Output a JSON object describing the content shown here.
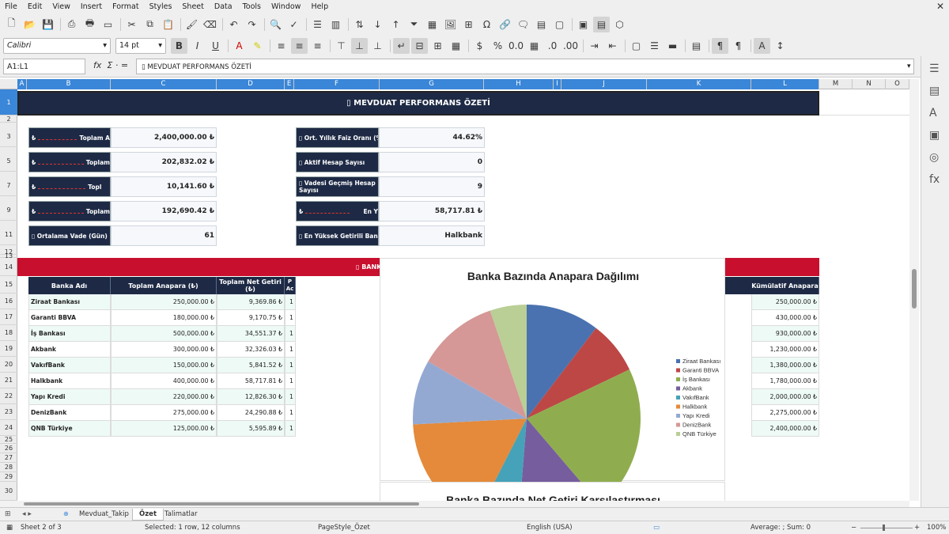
{
  "menu": [
    "File",
    "Edit",
    "View",
    "Insert",
    "Format",
    "Styles",
    "Sheet",
    "Data",
    "Tools",
    "Window",
    "Help"
  ],
  "font": {
    "name": "Calibri",
    "size": "14 pt"
  },
  "namebox": "A1:L1",
  "formula": "▯ MEVDUAT PERFORMANS ÖZETİ",
  "columns": [
    "A",
    "B",
    "C",
    "D",
    "E",
    "F",
    "G",
    "H",
    "I",
    "J",
    "K",
    "L",
    "M",
    "N",
    "O"
  ],
  "rows": [
    "1",
    "2",
    "3",
    "5",
    "7",
    "9",
    "11",
    "12",
    "13",
    "14",
    "15",
    "16",
    "17",
    "18",
    "19",
    "20",
    "21",
    "22",
    "23",
    "24",
    "25",
    "26",
    "27",
    "28",
    "29",
    "30"
  ],
  "title": "▯ MEVDUAT PERFORMANS ÖZETİ",
  "left_cards": [
    {
      "label": "Toplam A",
      "value": "2,400,000.00 ₺"
    },
    {
      "label": "Toplam ",
      "value": "202,832.02 ₺"
    },
    {
      "label": "Topl",
      "value": "10,141.60 ₺"
    },
    {
      "label": "Toplam",
      "value": "192,690.42 ₺"
    },
    {
      "label": "▯ Ortalama Vade (Gün)",
      "value": "61"
    }
  ],
  "right_cards": [
    {
      "label": "▯ Ort. Yıllık Faiz Oranı (%)",
      "value": "44.62%"
    },
    {
      "label": "▯ Aktif Hesap Sayısı",
      "value": "0"
    },
    {
      "label": "▯ Vadesi Geçmiş Hesap Sayısı",
      "value": "9"
    },
    {
      "label": "En Y",
      "value": "58,717.81 ₺"
    },
    {
      "label": "▯ En Yüksek Getirili Banka",
      "value": "Halkbank"
    }
  ],
  "section_banner": "▯ BANK",
  "table": {
    "headers": [
      "Banka Adı",
      "Toplam Anapara (₺)",
      "Toplam Net Getiri (₺)",
      "P Ac",
      "Kümülatif Anapara"
    ],
    "rows": [
      {
        "bank": "Ziraat Bankası",
        "principal": "250,000.00 ₺",
        "net": "9,369.86 ₺",
        "p": "1",
        "cum": "250,000.00 ₺"
      },
      {
        "bank": "Garanti BBVA",
        "principal": "180,000.00 ₺",
        "net": "9,170.75 ₺",
        "p": "1",
        "cum": "430,000.00 ₺"
      },
      {
        "bank": "İş Bankası",
        "principal": "500,000.00 ₺",
        "net": "34,551.37 ₺",
        "p": "1",
        "cum": "930,000.00 ₺"
      },
      {
        "bank": "Akbank",
        "principal": "300,000.00 ₺",
        "net": "32,326.03 ₺",
        "p": "1",
        "cum": "1,230,000.00 ₺"
      },
      {
        "bank": "VakıfBank",
        "principal": "150,000.00 ₺",
        "net": "5,841.52 ₺",
        "p": "1",
        "cum": "1,380,000.00 ₺"
      },
      {
        "bank": "Halkbank",
        "principal": "400,000.00 ₺",
        "net": "58,717.81 ₺",
        "p": "1",
        "cum": "1,780,000.00 ₺"
      },
      {
        "bank": "Yapı Kredi",
        "principal": "220,000.00 ₺",
        "net": "12,826.30 ₺",
        "p": "1",
        "cum": "2,000,000.00 ₺"
      },
      {
        "bank": "DenizBank",
        "principal": "275,000.00 ₺",
        "net": "24,290.88 ₺",
        "p": "1",
        "cum": "2,275,000.00 ₺"
      },
      {
        "bank": "QNB Türkiye",
        "principal": "125,000.00 ₺",
        "net": "5,595.89 ₺",
        "p": "1",
        "cum": "2,400,000.00 ₺"
      }
    ]
  },
  "chart_data": [
    {
      "type": "pie",
      "title": "Banka Bazında Anapara Dağılımı",
      "categories": [
        "Ziraat Bankası",
        "Garanti BBVA",
        "İş Bankası",
        "Akbank",
        "VakıfBank",
        "Halkbank",
        "Yapı Kredi",
        "DenizBank",
        "QNB Türkiye"
      ],
      "values": [
        250000,
        180000,
        500000,
        300000,
        150000,
        400000,
        220000,
        275000,
        125000
      ],
      "colors": [
        "#4a72b0",
        "#bd4745",
        "#8fad4f",
        "#765d9e",
        "#45a2b8",
        "#e48a3a",
        "#94a9d2",
        "#d59896",
        "#b9cf95"
      ],
      "legend": "right"
    },
    {
      "type": "bar",
      "title": "Banka Bazında Net Getiri Karşılaştırması"
    }
  ],
  "sheet_tabs": [
    "Mevduat_Takip",
    "Özet",
    "Talimatlar"
  ],
  "status": {
    "sheet": "Sheet 2 of 3",
    "selection": "Selected: 1 row, 12 columns",
    "page_style": "PageStyle_Özet",
    "language": "English (USA)",
    "summary": "Average: ; Sum: 0",
    "zoom": "100%"
  }
}
